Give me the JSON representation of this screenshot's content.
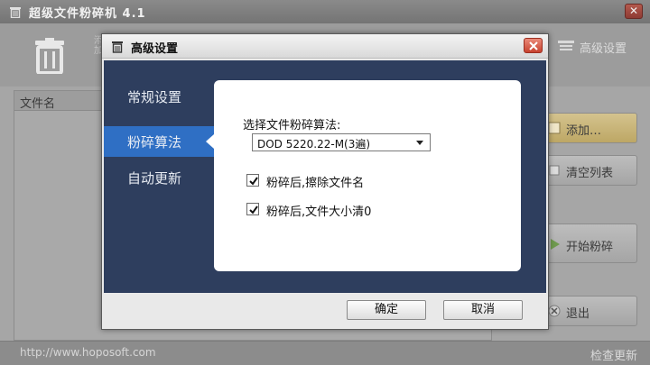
{
  "main_window": {
    "title": "超级文件粉碎机 4.1",
    "close_glyph": "✕",
    "trash_hint": "添加...",
    "settings_link": "高级设置",
    "file_list": {
      "column_name": "文件名"
    },
    "buttons": {
      "add": "添加…",
      "clear": "清空列表",
      "start": "开始粉碎",
      "exit": "退出"
    },
    "status": {
      "url": "http://www.hoposoft.com",
      "update": "检查更新"
    }
  },
  "dialog": {
    "title": "高级设置",
    "nav": [
      {
        "label": "常规设置",
        "selected": false
      },
      {
        "label": "粉碎算法",
        "selected": true
      },
      {
        "label": "自动更新",
        "selected": false
      }
    ],
    "algorithm": {
      "label": "选择文件粉碎算法:",
      "selected": "DOD 5220.22-M(3遍)"
    },
    "options": [
      {
        "label": "粉碎后,擦除文件名",
        "checked": true
      },
      {
        "label": "粉碎后,文件大小清0",
        "checked": true
      }
    ],
    "ok": "确定",
    "cancel": "取消"
  },
  "colors": {
    "nav_bg": "#2e3e5e",
    "nav_selected": "#2f6fc4",
    "close_red": "#c7422f",
    "add_button": "#c9b579"
  },
  "icons": [
    "trash-icon",
    "settings-icon",
    "close-icon",
    "add-icon",
    "clear-icon",
    "play-icon",
    "exit-icon",
    "checkmark-icon",
    "dropdown-arrow-icon"
  ]
}
